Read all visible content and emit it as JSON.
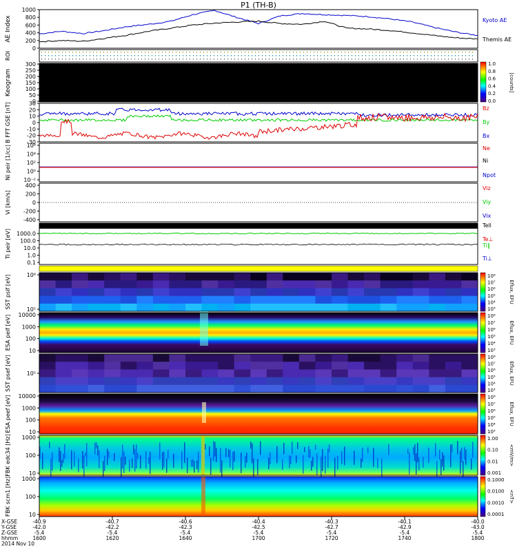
{
  "title": "P1 (TH-B)",
  "colors": {
    "blue": "#0000cc",
    "red": "#dd0000",
    "green": "#00cc00",
    "black": "#000000",
    "yellow": "#ffff00"
  },
  "chart_data": [
    {
      "type": "line",
      "panel": "AE Index",
      "ylabel": "AE Index",
      "ylim": [
        0,
        1000
      ],
      "ticks": [
        "1000",
        "800",
        "600",
        "400",
        "200",
        "0"
      ],
      "series": [
        {
          "name": "Kyoto AE",
          "color": "#0000cc"
        },
        {
          "name": "Themis AE",
          "color": "#000000"
        }
      ],
      "x": [
        1600,
        1610,
        1620,
        1630,
        1640,
        1650,
        1660,
        1670,
        1680,
        1690,
        1700,
        1710,
        1720,
        1730,
        1740,
        1750,
        1760,
        1770,
        1780,
        1790,
        1800
      ],
      "kyoto": [
        370,
        440,
        380,
        460,
        560,
        620,
        700,
        870,
        980,
        800,
        640,
        840,
        900,
        870,
        850,
        820,
        760,
        680,
        540,
        420,
        330
      ],
      "themis": [
        170,
        200,
        180,
        260,
        340,
        440,
        520,
        600,
        650,
        680,
        700,
        640,
        620,
        700,
        520,
        500,
        460,
        400,
        330,
        270,
        240
      ]
    },
    {
      "type": "heatmap",
      "panel": "ROI",
      "ylabel": "ROI"
    },
    {
      "type": "heatmap",
      "panel": "Keogram",
      "ylabel": "Keogram",
      "ticks": [
        "300",
        "250",
        "200",
        "150",
        "100",
        "50",
        "0"
      ],
      "colorbar": {
        "label": "[counts]",
        "ticks": [
          "1.0",
          "0.8",
          "0.6",
          "0.4",
          "0.2",
          "0.0"
        ]
      }
    },
    {
      "type": "line",
      "panel": "B_FFT",
      "ylabel": "B FFT GSE [nT]",
      "ylim": [
        -10,
        30
      ],
      "ticks": [
        "30",
        "20",
        "10",
        "0",
        "-10",
        "-20",
        "-30"
      ],
      "series": [
        {
          "name": "Bz",
          "color": "#dd0000"
        },
        {
          "name": "By",
          "color": "#00cc00"
        },
        {
          "name": "Bx",
          "color": "#0000cc"
        }
      ]
    },
    {
      "type": "line",
      "panel": "Ni",
      "ylabel": "Ni peir [1/cc]",
      "ticks": [
        "10⁶",
        "10⁴",
        "10²",
        "10⁰",
        "10⁻²"
      ],
      "series": [
        {
          "name": "Ne",
          "color": "#dd0000"
        },
        {
          "name": "Ni",
          "color": "#000000"
        },
        {
          "name": "Npot",
          "color": "#0000cc"
        }
      ]
    },
    {
      "type": "line",
      "panel": "Vi",
      "ylabel": "Vi [km/s]",
      "ylim": [
        -400,
        400
      ],
      "ticks": [
        "400",
        "200",
        "0",
        "-200",
        "-400"
      ],
      "series": [
        {
          "name": "Viz",
          "color": "#dd0000"
        },
        {
          "name": "Viy",
          "color": "#00cc00"
        },
        {
          "name": "Vix",
          "color": "#0000cc"
        }
      ]
    },
    {
      "type": "line",
      "panel": "Ti",
      "ylabel": "Ti peir [eV]",
      "ticks": [
        "1000.0",
        "100.0",
        "10.0",
        "1.0",
        "0.1"
      ],
      "series": [
        {
          "name": "Tell",
          "color": "#000000"
        },
        {
          "name": "Te⊥",
          "color": "#dd0000"
        },
        {
          "name": "Ti‖",
          "color": "#00cc00"
        },
        {
          "name": "Ti⊥",
          "color": "#0000cc"
        }
      ]
    },
    {
      "type": "heatmap",
      "panel": "SST ion",
      "ylabel": "SST psif [eV]",
      "ticks": [
        "10⁶",
        "10⁵"
      ],
      "colorbar": {
        "label": "Eflux, EFU",
        "ticks": [
          "10⁸",
          "10⁷",
          "10⁶",
          "10⁵",
          "10⁴",
          "10³"
        ]
      }
    },
    {
      "type": "heatmap",
      "panel": "ESA ion",
      "ylabel": "ESA peif [eV]",
      "ticks": [
        "10000",
        "1000",
        "100",
        "10"
      ],
      "colorbar": {
        "label": "Eflux, EFU",
        "ticks": [
          "10⁸",
          "10⁷",
          "10⁶",
          "10⁵",
          "10⁴",
          "10³"
        ]
      }
    },
    {
      "type": "heatmap",
      "panel": "SST electron",
      "ylabel": "SST psef [eV]",
      "ticks": [
        "10⁵"
      ],
      "colorbar": {
        "label": "Eflux, EFU",
        "ticks": [
          "10⁸",
          "10⁷",
          "10⁶",
          "10⁵",
          "10⁴",
          "10³"
        ]
      }
    },
    {
      "type": "heatmap",
      "panel": "ESA electron",
      "ylabel": "ESA peef [eV]",
      "ticks": [
        "10000",
        "1000",
        "100",
        "10"
      ],
      "colorbar": {
        "label": "Eflux, EFU",
        "ticks": [
          "10⁸",
          "10⁷",
          "10⁶",
          "10⁵",
          "10⁴",
          "10³"
        ]
      }
    },
    {
      "type": "heatmap",
      "panel": "FBK edc",
      "ylabel": "FBK edc34 [Hz]",
      "ticks": [
        "1000",
        "100",
        "10"
      ],
      "colorbar": {
        "label": "<mV/m>",
        "ticks": [
          "1.00",
          "0.10",
          "0.01",
          "0.001"
        ]
      }
    },
    {
      "type": "heatmap",
      "panel": "FBK scm",
      "ylabel": "FBK scm1 [Hz]",
      "ticks": [
        "1000",
        "100",
        "10"
      ],
      "colorbar": {
        "label": "<nT>",
        "ticks": [
          "0.1000",
          "0.0100",
          "0.0010",
          "0.0001"
        ]
      }
    }
  ],
  "xaxis": {
    "row_labels": [
      "X-GSE",
      "Y-GSE",
      "Z-GSE",
      "hhmm",
      "2014 Nov 10"
    ],
    "ticks": [
      {
        "x": "-40.9",
        "y": "-42.0",
        "z": "-5.4",
        "t": "1600"
      },
      {
        "x": "-40.7",
        "y": "-42.2",
        "z": "-5.4",
        "t": "1620"
      },
      {
        "x": "-40.6",
        "y": "-42.3",
        "z": "-5.4",
        "t": "1640"
      },
      {
        "x": "-40.4",
        "y": "-42.5",
        "z": "-5.4",
        "t": "1700"
      },
      {
        "x": "-40.3",
        "y": "-42.7",
        "z": "-5.4",
        "t": "1720"
      },
      {
        "x": "-40.1",
        "y": "-42.9",
        "z": "-5.4",
        "t": "1740"
      },
      {
        "x": "-40.0",
        "y": "-43.0",
        "z": "-5.4",
        "t": "1800"
      }
    ]
  }
}
